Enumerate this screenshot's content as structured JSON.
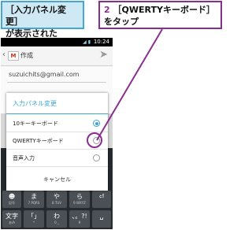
{
  "callouts": {
    "left_line1": "［入力パネル変更］",
    "left_line2": "が表示された",
    "right_num": "2",
    "right_line1": "［QWERTYキーボード］",
    "right_line2": "をタップ"
  },
  "statusbar": {
    "time": "10:24",
    "icons": "◢ ▮"
  },
  "actionbar": {
    "back_icon": "‹",
    "gmail_icon": "M",
    "title": "作成",
    "send_icon": "➤"
  },
  "compose": {
    "from": "suzuichits@gmail.com"
  },
  "dialog": {
    "title": "入力パネル変更",
    "options": [
      {
        "label": "10キーキーボード",
        "selected": true
      },
      {
        "label": "QWERTYキーボード",
        "selected": false
      },
      {
        "label": "音声入力",
        "selected": false
      }
    ],
    "cancel": "キャンセル"
  },
  "keyboard": {
    "keys": [
      {
        "main": "☻",
        "sub": "記号"
      },
      {
        "main": "ま",
        "sub": "7 PQRS"
      },
      {
        "main": "や",
        "sub": "8 TUV"
      },
      {
        "main": "ら",
        "sub": "9 WXYZ"
      },
      {
        "main": "⏎",
        "sub": ""
      },
      {
        "main": "文字",
        "sub": "あ/A"
      },
      {
        "main": "「」",
        "sub": "*"
      },
      {
        "main": "わ",
        "sub": "0 _"
      },
      {
        "main": "、。?!",
        "sub": "#"
      },
      {
        "main": "␣",
        "sub": ""
      }
    ]
  },
  "colors": {
    "accent": "#3aa6d4",
    "callout": "#8a2f90",
    "callout_left_fill": "#cfe9f4"
  }
}
